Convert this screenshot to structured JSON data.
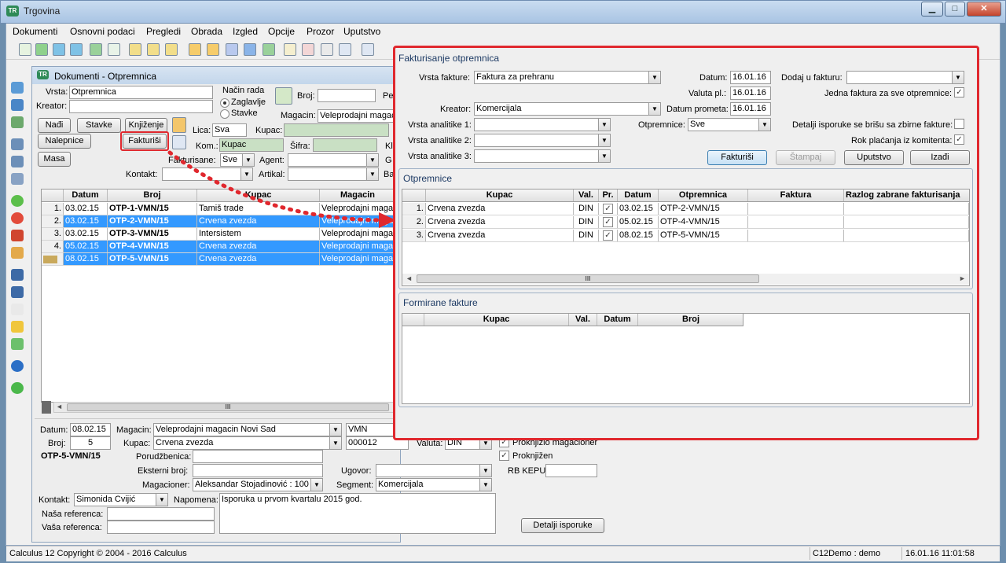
{
  "app": {
    "title": "Trgovina",
    "icon_text": "TR"
  },
  "window_buttons": {
    "minimize": "▁",
    "maximize": "□",
    "close": "✕"
  },
  "menu": [
    "Dokumenti",
    "Osnovni podaci",
    "Pregledi",
    "Obrada",
    "Izgled",
    "Opcije",
    "Prozor",
    "Uputstvo"
  ],
  "toolbar_icons": [
    "number-icon",
    "refresh-icon",
    "forward-icon",
    "back-icon",
    "export-icon",
    "sheet-icon",
    "import-icon",
    "doc-arrow-icon",
    "doc-edit-icon",
    "doc-pen-icon",
    "doc-copy-icon",
    "doc-save-icon",
    "doc-green-icon",
    "window-icon",
    "window-red-icon",
    "sum-icon",
    "calendar-icon",
    "columns-icon",
    "grid-icon"
  ],
  "left_toolbar_icons": [
    "save-icon",
    "disk-icon",
    "table-icon",
    "print-icon",
    "print-preview-icon",
    "copy-icon",
    "binoculars-icon",
    "add-icon",
    "delete-icon",
    "undo-icon",
    "edit-icon",
    "find-icon",
    "find-next-icon",
    "sort-icon",
    "filter-icon",
    "arrows-icon",
    "help-icon",
    "ok-icon"
  ],
  "docwin": {
    "title": "Dokumenti - Otpremnica",
    "vrsta_label": "Vrsta:",
    "vrsta_value": "Otpremnica",
    "kreator_label": "Kreator:",
    "kreator_value": "",
    "nacin_rada_label": "Način rada",
    "zaglavlje_label": "Zaglavlje",
    "stavke_radio_label": "Stavke",
    "broj_label": "Broj:",
    "pe_label": "Pe",
    "magacin_label": "Magacin:",
    "magacin_value": "Veleprodajni magaci",
    "btn_nadji": "Nađi",
    "btn_stavke": "Stavke",
    "btn_knjizenje": "Knjiženje",
    "btn_nalepnice": "Nalepnice",
    "btn_fakturisi": "Fakturiši",
    "btn_masa": "Masa",
    "lica_label": "Lica:",
    "lica_value": "Sva",
    "kupac_label": "Kupac:",
    "kom_label": "Kom.:",
    "kom_value": "Kupac",
    "sifra_label": "Šifra:",
    "kl_label": "Kl",
    "fakturisane_label": "Fakturisane:",
    "fakturisane_value": "Sve",
    "agent_label": "Agent:",
    "g_label": "G",
    "kontakt_label": "Kontakt:",
    "artikal_label": "Artikal:",
    "ba_label": "Ba",
    "columns": [
      "Datum",
      "Broj",
      "Kupac",
      "Magacin"
    ],
    "rows": [
      {
        "n": "1.",
        "datum": "03.02.15",
        "broj": "OTP-1-VMN/15",
        "kupac": "Tamiš trade",
        "magacin": "Veleprodajni magacin",
        "selected": false
      },
      {
        "n": "2.",
        "datum": "03.02.15",
        "broj": "OTP-2-VMN/15",
        "kupac": "Crvena zvezda",
        "magacin": "Veleprodajni magacin",
        "selected": true
      },
      {
        "n": "3.",
        "datum": "03.02.15",
        "broj": "OTP-3-VMN/15",
        "kupac": "Intersistem",
        "magacin": "Veleprodajni magacin",
        "selected": false
      },
      {
        "n": "4.",
        "datum": "05.02.15",
        "broj": "OTP-4-VMN/15",
        "kupac": "Crvena zvezda",
        "magacin": "Veleprodajni magacin",
        "selected": true
      },
      {
        "n": "",
        "datum": "08.02.15",
        "broj": "OTP-5-VMN/15",
        "kupac": "Crvena zvezda",
        "magacin": "Veleprodajni magacin",
        "selected": true
      }
    ],
    "scroll_mid": "III"
  },
  "detail": {
    "datum_label": "Datum:",
    "datum_value": "08.02.15",
    "magacin_label": "Magacin:",
    "magacin_value": "Veleprodajni magacin Novi Sad",
    "magacin_code": "VMN",
    "broj_label": "Broj:",
    "broj_value": "5",
    "kupac_label": "Kupac:",
    "kupac_value": "Crvena zvezda",
    "kupac_code": "000012",
    "valuta_label": "Valuta:",
    "valuta_value": "DIN",
    "proknjizio_label": "Proknjižio magacioner",
    "doc_number": "OTP-5-VMN/15",
    "porudzbenica_label": "Porudžbenica:",
    "proknjizen_label": "Proknjižen",
    "eksterni_label": "Eksterni broj:",
    "ugovor_label": "Ugovor:",
    "rbkepu_label": "RB KEPU:",
    "magacioner_label": "Magacioner:",
    "magacioner_value": "Aleksandar Stojadinović : 100",
    "segment_label": "Segment:",
    "segment_value": "Komercijala",
    "kontakt_label": "Kontakt:",
    "kontakt_value": "Simonida Cvijić",
    "napomena_label": "Napomena:",
    "napomena_value": "Isporuka u prvom kvartalu 2015 god.",
    "nasa_label": "Naša referenca:",
    "vasa_label": "Vaša referenca:",
    "btn_detalji": "Detalji isporuke"
  },
  "dialog": {
    "title": "Fakturisanje otpremnica",
    "vrsta_fakture_label": "Vrsta fakture:",
    "vrsta_fakture_value": "Faktura za prehranu",
    "datum_label": "Datum:",
    "datum_value": "16.01.16",
    "dodaj_label": "Dodaj u fakturu:",
    "valuta_label": "Valuta pl.:",
    "valuta_value": "16.01.16",
    "jedna_label": "Jedna faktura za sve otpremnice:",
    "kreator_label": "Kreator:",
    "kreator_value": "Komercijala",
    "datum_prometa_label": "Datum prometa:",
    "datum_prometa_value": "16.01.16",
    "va1_label": "Vrsta analitike 1:",
    "va2_label": "Vrsta analitike 2:",
    "va3_label": "Vrsta analitike 3:",
    "otpremnice_label": "Otpremnice:",
    "otpremnice_value": "Sve",
    "detalji_label": "Detalji isporuke se brišu sa zbirne fakture:",
    "rok_label": "Rok plaćanja iz komitenta:",
    "btn_fakturisi": "Fakturiši",
    "btn_stampaj": "Štampaj",
    "btn_uputstvo": "Uputstvo",
    "btn_izadji": "Izađi",
    "otp_panel_title": "Otpremnice",
    "otp_columns": [
      "Kupac",
      "Val.",
      "Pr.",
      "Datum",
      "Otpremnica",
      "Faktura",
      "Razlog zabrane fakturisanja"
    ],
    "otp_rows": [
      {
        "n": "1.",
        "kupac": "Crvena zvezda",
        "val": "DIN",
        "pr": "✓",
        "datum": "03.02.15",
        "otp": "OTP-2-VMN/15"
      },
      {
        "n": "2.",
        "kupac": "Crvena zvezda",
        "val": "DIN",
        "pr": "✓",
        "datum": "05.02.15",
        "otp": "OTP-4-VMN/15"
      },
      {
        "n": "3.",
        "kupac": "Crvena zvezda",
        "val": "DIN",
        "pr": "✓",
        "datum": "08.02.15",
        "otp": "OTP-5-VMN/15"
      }
    ],
    "ff_panel_title": "Formirane fakture",
    "ff_columns": [
      "Kupac",
      "Val.",
      "Datum",
      "Broj"
    ],
    "scroll_mid": "III"
  },
  "status": {
    "left": "Calculus 12  Copyright © 2004 - 2016  Calculus",
    "user": "C12Demo : demo",
    "time": "16.01.16 11:01:58"
  },
  "colors": {
    "selection": "#3399ff",
    "highlight": "#e0282e",
    "green_field": "#c9e0c4"
  }
}
